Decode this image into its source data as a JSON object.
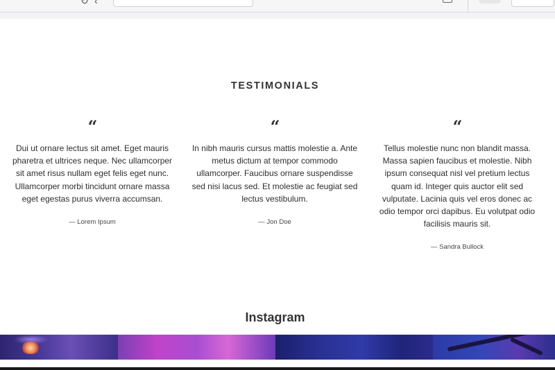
{
  "testimonials": {
    "title": "TESTIMONIALS",
    "quote_mark": "“",
    "items": [
      {
        "text": "Dui ut ornare lectus sit amet. Eget mauris pharetra et ultrices neque. Nec ullamcorper sit amet risus nullam eget felis eget nunc. Ullamcorper morbi tincidunt ornare massa eget egestas purus viverra accumsan.",
        "author": "— Lorem Ipsum"
      },
      {
        "text": "In nibh mauris cursus mattis molestie a. Ante metus dictum at tempor commodo ullamcorper. Faucibus ornare suspendisse sed nisi lacus sed. Et molestie ac feugiat sed lectus vestibulum.",
        "author": "— Jon Doe"
      },
      {
        "text": "Tellus molestie nunc non blandit massa. Massa sapien faucibus et molestie. Nibh ipsum consequat nisl vel pretium lectus quam id. Integer quis auctor elit sed vulputate. Lacinia quis vel eros donec ac odio tempor orci dapibus. Eu volutpat odio facilisis mauris sit.",
        "author": "— Sandra Bullock"
      }
    ]
  },
  "instagram": {
    "title": "Instagram"
  },
  "colors": {
    "text": "#333333",
    "background": "#ffffff"
  }
}
